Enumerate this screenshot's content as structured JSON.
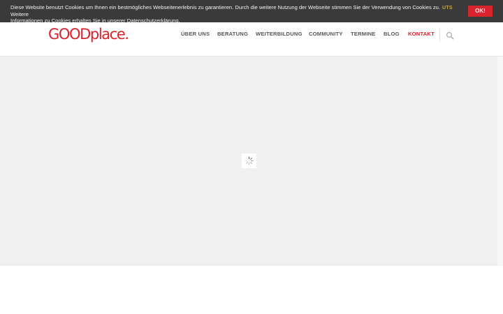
{
  "cookie_bar": {
    "message_line1": "Diese Website benutzt Cookies um Ihnen ein bestmögliches Webseitenerlebnis zu garantieren. Durch die weitere Nutzung der Webseite stimmen Sie der Verwendung von Cookies zu. Weitere",
    "message_line2": "Informationen zu Cookies erhalten Sie in unserer ",
    "link_label": "Datenschutzerklärung",
    "after_link": ".",
    "ok_label": "OK!",
    "peek_text": "UTS",
    "button_color": "#d9232d"
  },
  "header": {
    "logo_caps": "GOOD",
    "logo_rest": "place.",
    "brand_color": "#d9232d",
    "nav": [
      {
        "label": "ÜBER UNS"
      },
      {
        "label": "BERATUNG"
      },
      {
        "label": "WEITERBILDUNG"
      },
      {
        "label": "COMMUNITY"
      },
      {
        "label": "TERMINE"
      },
      {
        "label": "BLOG"
      },
      {
        "label": "KONTAKT",
        "active": true
      }
    ],
    "search_icon": "search-icon"
  },
  "main": {
    "loader_icon": "spinner-icon"
  }
}
